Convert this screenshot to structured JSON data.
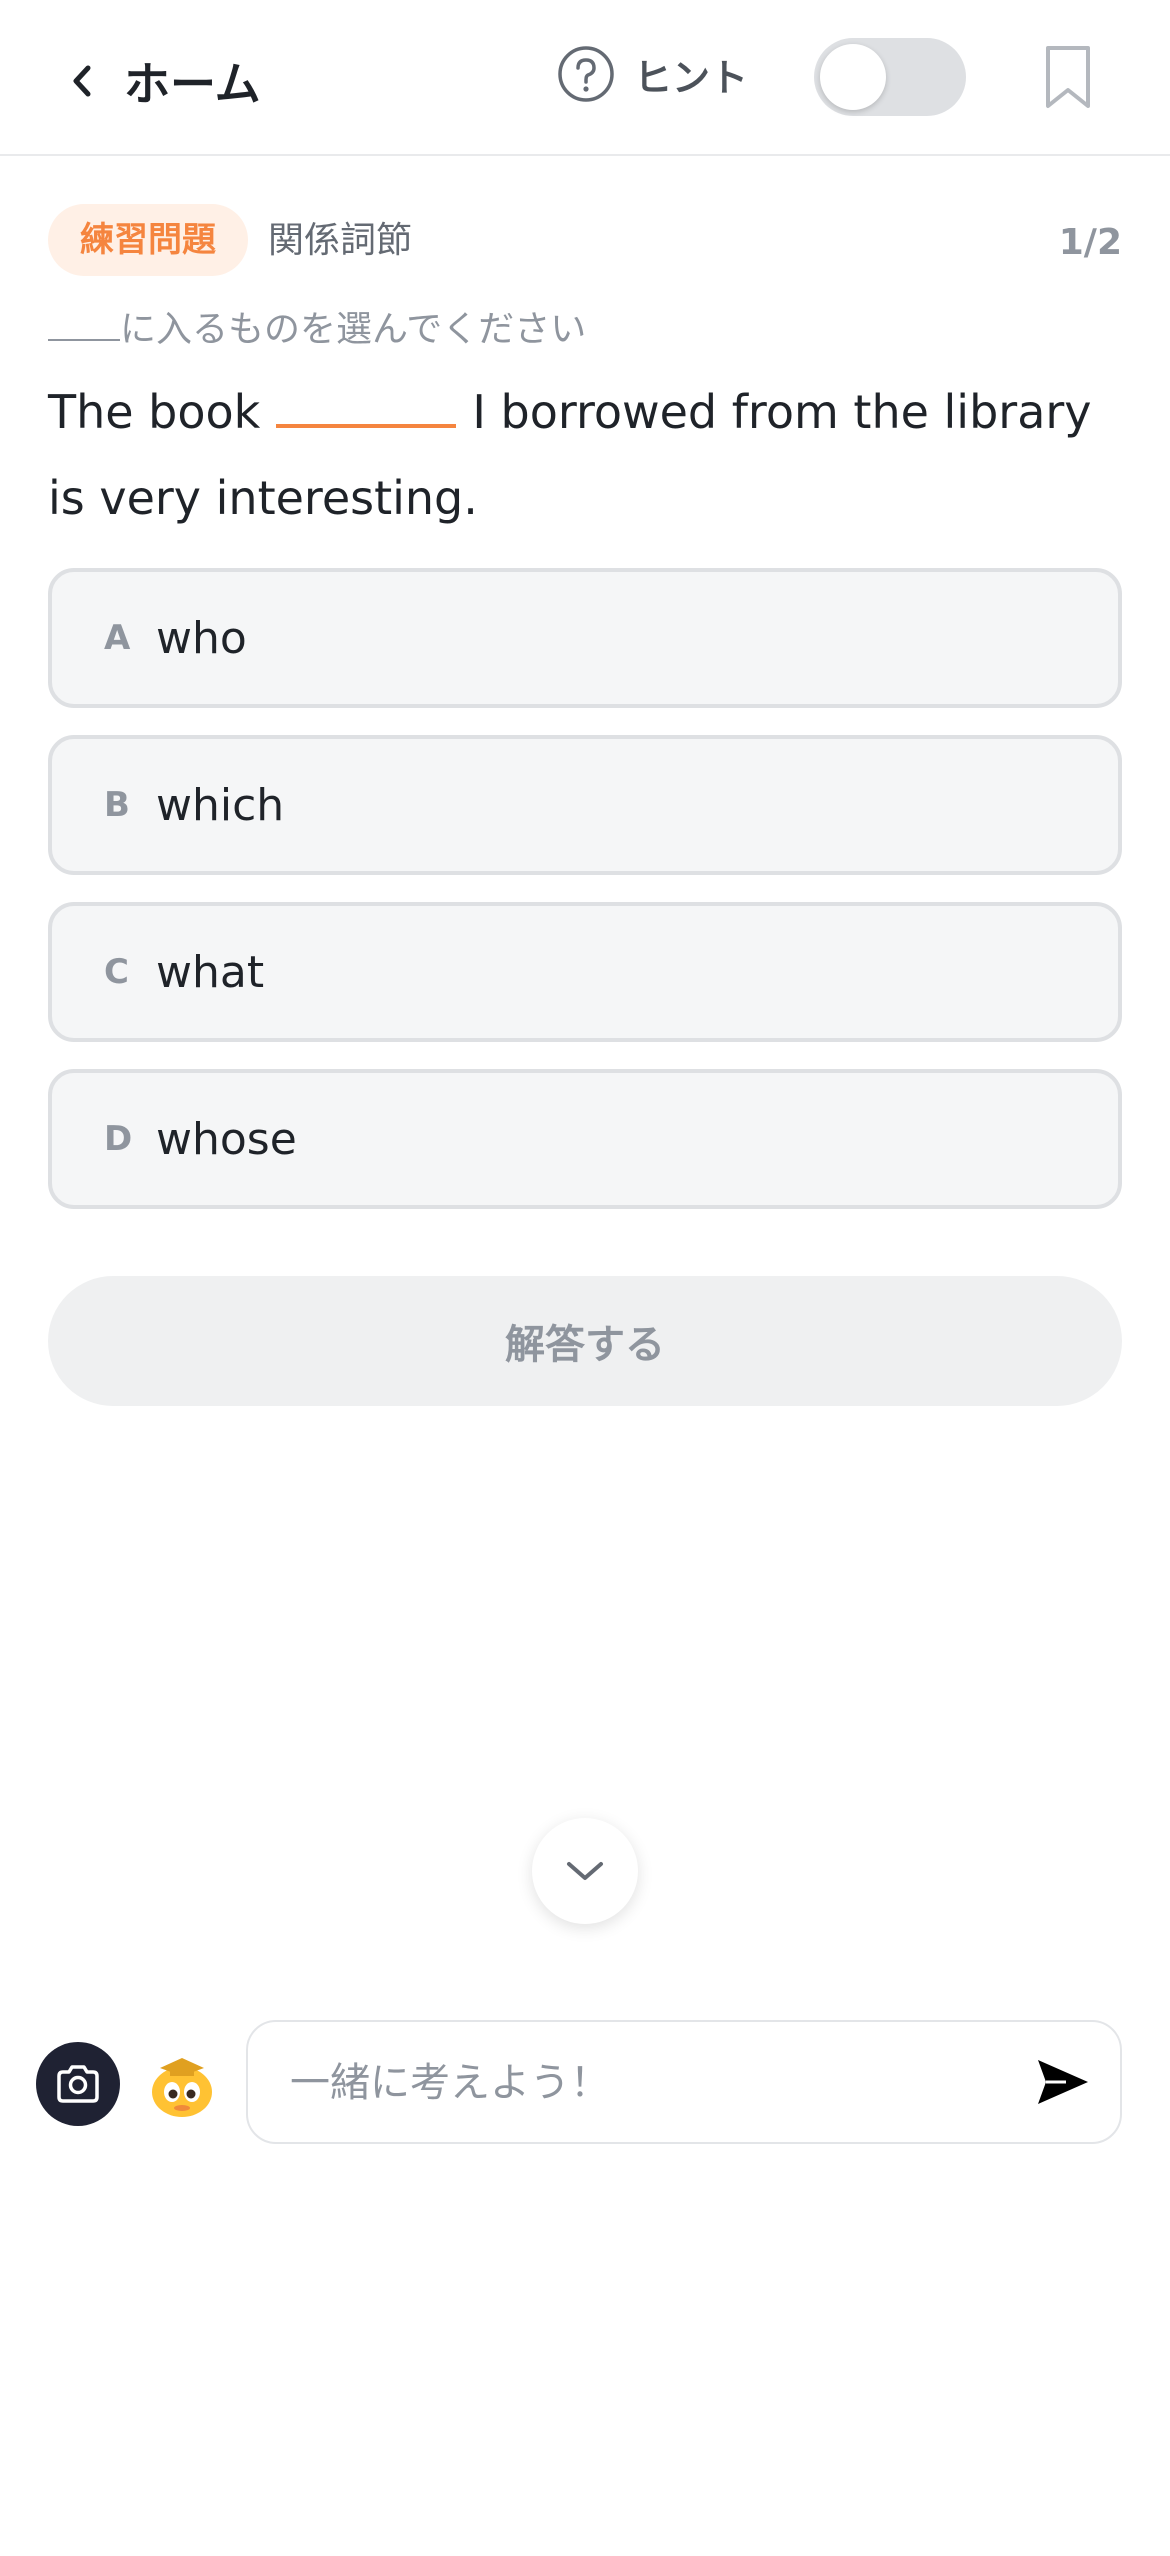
{
  "header": {
    "back_label": "ホーム",
    "hint_label": "ヒント",
    "hint_toggle_on": false
  },
  "question": {
    "tag": "練習問題",
    "topic": "関係詞節",
    "progress": "1/2",
    "instruction": "に入るものを選んでください",
    "text_before": "The book",
    "text_after": "I borrowed from the library is very interesting."
  },
  "options": [
    {
      "letter": "A",
      "text": "who"
    },
    {
      "letter": "B",
      "text": "which"
    },
    {
      "letter": "C",
      "text": "what"
    },
    {
      "letter": "D",
      "text": "whose"
    }
  ],
  "submit_label": "解答する",
  "chat": {
    "placeholder": "一緒に考えよう！"
  },
  "colors": {
    "accent": "#f5853f",
    "tag_bg": "#fff0e6",
    "camera_bg": "#1f2233"
  }
}
